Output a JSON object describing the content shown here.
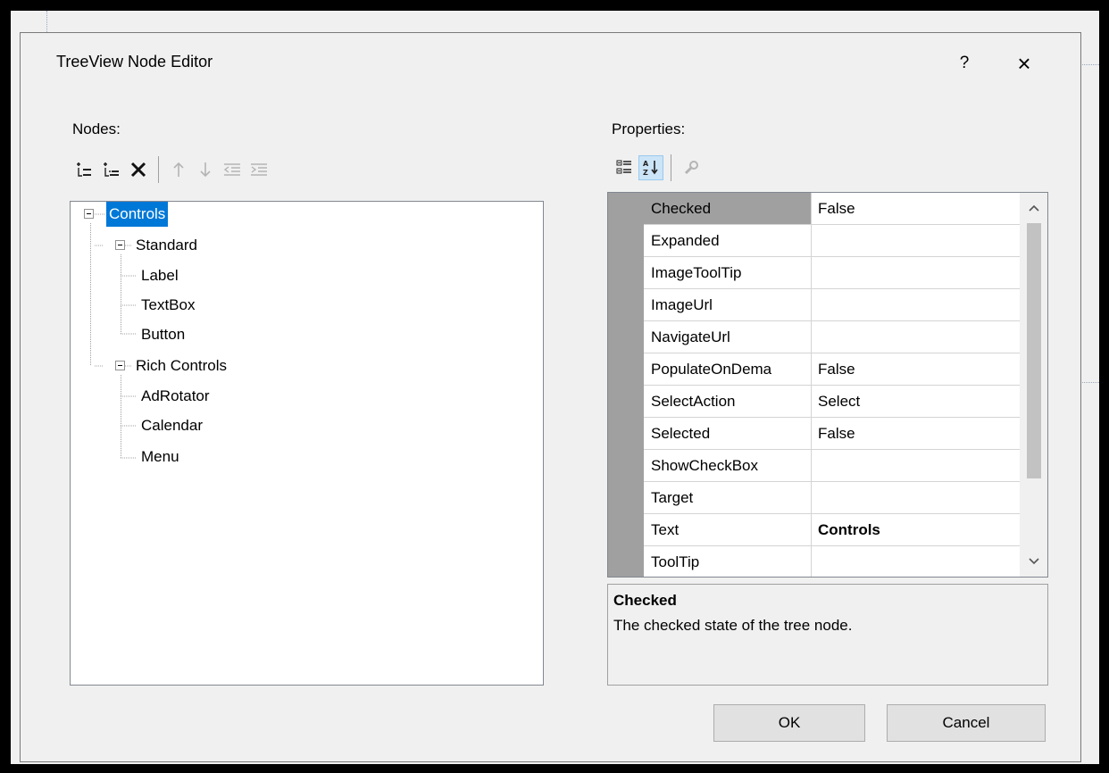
{
  "window": {
    "title": "TreeView Node Editor",
    "help_label": "?",
    "close_label": "×"
  },
  "nodes_panel": {
    "label": "Nodes:",
    "toolbar": [
      {
        "icon": "add-root-node-icon",
        "enabled": true
      },
      {
        "icon": "add-child-node-icon",
        "enabled": true
      },
      {
        "icon": "delete-node-icon",
        "enabled": true
      },
      {
        "icon": "move-up-icon",
        "enabled": false
      },
      {
        "icon": "move-down-icon",
        "enabled": false
      },
      {
        "icon": "outdent-icon",
        "enabled": false
      },
      {
        "icon": "indent-icon",
        "enabled": false
      }
    ],
    "tree": {
      "root": "Controls",
      "groups": [
        {
          "label": "Standard",
          "children": [
            "Label",
            "TextBox",
            "Button"
          ]
        },
        {
          "label": "Rich Controls",
          "children": [
            "AdRotator",
            "Calendar",
            "Menu"
          ]
        }
      ]
    }
  },
  "properties_panel": {
    "label": "Properties:",
    "toolbar": [
      {
        "icon": "categorized-icon",
        "selected": false
      },
      {
        "icon": "alphabetical-icon",
        "selected": true
      },
      {
        "icon": "property-pages-icon",
        "enabled": false
      }
    ],
    "rows": [
      {
        "name": "Checked",
        "value": "False",
        "bold": false
      },
      {
        "name": "Expanded",
        "value": "",
        "bold": false
      },
      {
        "name": "ImageToolTip",
        "value": "",
        "bold": false
      },
      {
        "name": "ImageUrl",
        "value": "",
        "bold": false
      },
      {
        "name": "NavigateUrl",
        "value": "",
        "bold": false
      },
      {
        "name": "PopulateOnDema",
        "value": "False",
        "bold": false
      },
      {
        "name": "SelectAction",
        "value": "Select",
        "bold": false
      },
      {
        "name": "Selected",
        "value": "False",
        "bold": false
      },
      {
        "name": "ShowCheckBox",
        "value": "",
        "bold": false
      },
      {
        "name": "Target",
        "value": "",
        "bold": false
      },
      {
        "name": "Text",
        "value": "Controls",
        "bold": true
      },
      {
        "name": "ToolTip",
        "value": "",
        "bold": false
      }
    ],
    "description": {
      "title": "Checked",
      "text": "The checked state of the tree node."
    }
  },
  "buttons": {
    "ok": "OK",
    "cancel": "Cancel"
  },
  "colors": {
    "selection": "#0078d7",
    "dialog_bg": "#f0f0f0",
    "gutter": "#a0a0a0"
  }
}
